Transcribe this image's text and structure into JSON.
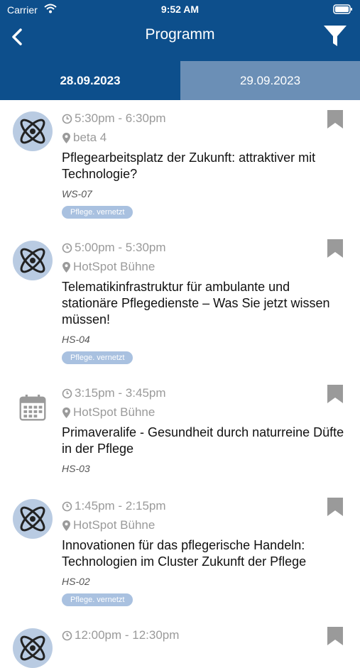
{
  "status_bar": {
    "carrier": "Carrier",
    "time": "9:52 AM"
  },
  "nav": {
    "title": "Programm"
  },
  "tabs": [
    {
      "label": "28.09.2023",
      "active": true
    },
    {
      "label": "29.09.2023",
      "active": false
    }
  ],
  "sessions": [
    {
      "time": "5:30pm - 6:30pm",
      "location": "beta 4",
      "title": "Pflegearbeitsplatz der Zukunft: attraktiver mit Technologie?",
      "code": "WS-07",
      "tag": "Pflege. vernetzt",
      "icon": "atom-icon"
    },
    {
      "time": "5:00pm - 5:30pm",
      "location": "HotSpot Bühne",
      "title": "Telematikinfrastruktur für ambulante und stationäre Pflegedienste – Was Sie jetzt wissen müssen!",
      "code": "HS-04",
      "tag": "Pflege. vernetzt",
      "icon": "atom-icon"
    },
    {
      "time": "3:15pm - 3:45pm",
      "location": "HotSpot Bühne",
      "title": "Primaveralife - Gesundheit durch naturreine Düfte in der Pflege",
      "code": "HS-03",
      "icon": "calendar-icon"
    },
    {
      "time": "1:45pm - 2:15pm",
      "location": "HotSpot Bühne",
      "title": "Innovationen für das pflegerische Handeln: Technologien im Cluster Zukunft der Pflege",
      "code": "HS-02",
      "tag": "Pflege. vernetzt",
      "icon": "atom-icon"
    },
    {
      "time": "12:00pm - 12:30pm",
      "icon": "atom-icon"
    }
  ],
  "colors": {
    "brand": "#0d4f8c",
    "tab_inactive": "#6b8fb6",
    "tag_bg": "#a9c1e0",
    "muted": "#9a9a9a"
  }
}
